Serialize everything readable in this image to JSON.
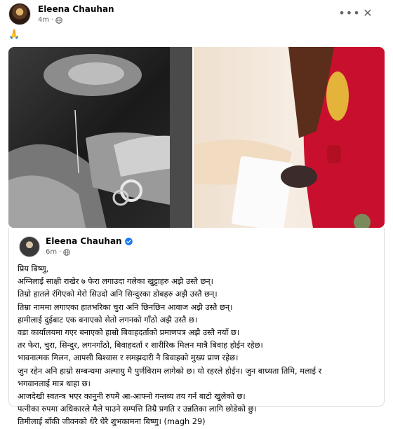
{
  "post": {
    "author": "Eleena Chauhan",
    "time": "4m",
    "separator": "·",
    "reaction": "🙏",
    "more_label": "•••",
    "close_label": "✕"
  },
  "shared_post": {
    "author": "Eleena Chauhan",
    "time": "6m",
    "separator": "·",
    "lines": [
      "प्रिय बिष्णु,",
      "अग्निलाई साक्षी राखेर ७ फेरा लगाउदा गलेका खुट्टाहरु अझै उस्तै छन्।",
      "तिम्रो हातले रंगिएको मेरो सिउदो अनि सिन्दुरका डोबहरु अझै उस्तै छन्।",
      "तिम्रा नाममा लगाएका हातभरिका चुरा अनि छिनछिन आवाज अझै उस्तै छन्।",
      "हामीलाई दुईबाट एक बनाएको सेतो लगनको गाँठो अझै उस्तै छ।",
      "वडा कार्यालयमा गएर बनाएको हाम्रो बिवाहदर्ताको प्रमाणपत्र अझै उस्तै नयाँ छ।",
      "तर फेरा, चुरा, सिन्दुर, लगनगाँठो, बिवाहदर्ता र शारीरिक मिलन मात्रै बिवाह होईन रहेछ।",
      "भावनात्मक मिलन, आपसी बिश्वास र समझदारी नै बिवाहको मुख्य प्राण रहेछ।",
      "जुन रहेन अनि हाम्रो सम्बन्धमा अल्पायु मै पुर्णविराम लागेको छ। यो रहरले होईन। जुन बाध्यता तिमि, मलाई र",
      "भगवानलाई मात्र थाहा छ।",
      "आजदेखी स्वतन्त्र भएर कानुनी रुपमै आ-आफ्नो गन्तव्य तय गर्न बाटो खुलेको छ।",
      "पत्नीका रुपमा अधिकारले मैले पाउने सम्पत्ति तिम्रै प्रगति र उन्नतिका लागि छोडेको छु।",
      "तिमीलाई बाँकी जीवनको धेरै धेरै शुभकामना बिष्णु। (magh 29)"
    ]
  },
  "icons": {
    "globe": "globe-icon",
    "verified": "verified-badge-icon",
    "more": "more-options-icon",
    "close": "close-icon"
  },
  "colors": {
    "verified_blue": "#1877f2",
    "meta_gray": "#65676b",
    "border": "#dadde1"
  }
}
